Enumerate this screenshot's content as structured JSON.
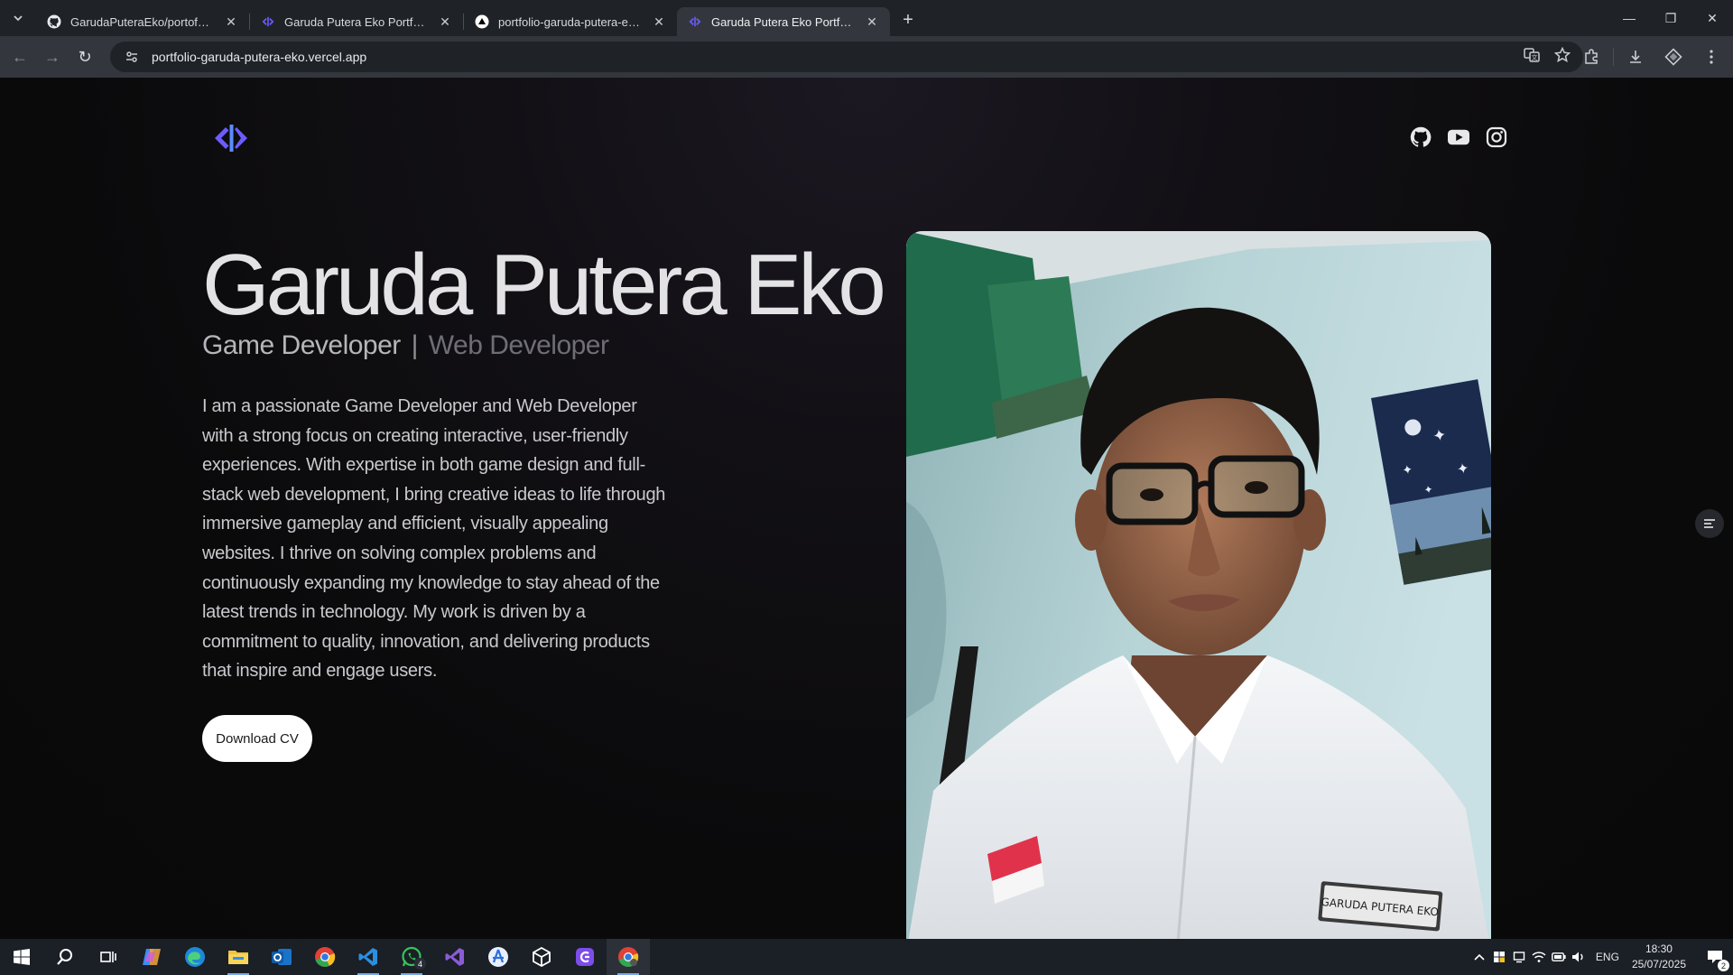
{
  "browser": {
    "tabs": [
      {
        "title": "GarudaPuteraEko/portofolio-garuda",
        "favicon": "github-icon",
        "active": false
      },
      {
        "title": "Garuda Putera Eko Portfolio",
        "favicon": "site-logo-icon",
        "active": false
      },
      {
        "title": "portfolio-garuda-putera-eko - Overview",
        "favicon": "vercel-icon",
        "active": false
      },
      {
        "title": "Garuda Putera Eko Portfolio",
        "favicon": "site-logo-icon",
        "active": true
      }
    ],
    "url": "portfolio-garuda-putera-eko.vercel.app"
  },
  "page": {
    "logo": "site-logo-icon",
    "social": [
      "github-icon",
      "youtube-icon",
      "instagram-icon"
    ],
    "hero": {
      "name": "Garuda Putera Eko",
      "role_primary": "Game Developer",
      "role_divider": "|",
      "role_secondary": "Web Developer",
      "bio": "I am a passionate Game Developer and Web Developer with a strong focus on creating interactive, user-friendly experiences. With expertise in both game design and full-stack web development, I bring creative ideas to life through immersive gameplay and efficient, visually appealing websites. I thrive on solving complex problems and continuously expanding my knowledge to stay ahead of the latest trends in technology. My work is driven by a commitment to quality, innovation, and delivering products that inspire and engage users.",
      "cta": "Download CV"
    },
    "photo_badge_text": "GARUDA PUTERA EKO"
  },
  "taskbar": {
    "apps": [
      "windows-start-icon",
      "search-icon",
      "task-view-icon",
      "copilot-icon",
      "edge-icon",
      "file-explorer-icon",
      "outlook-icon",
      "chrome-icon",
      "vscode-icon",
      "whatsapp-icon",
      "visual-studio-icon",
      "app-store-icon",
      "unity-icon",
      "game-app-icon",
      "chrome-active-icon"
    ],
    "whatsapp_badge": "4",
    "language": "ENG",
    "time": "18:30",
    "date": "25/07/2025",
    "notifications": "2"
  },
  "colors": {
    "accent_logo": "#6b5cff",
    "page_bg": "#0a0a0c",
    "button_bg": "#ffffff"
  }
}
